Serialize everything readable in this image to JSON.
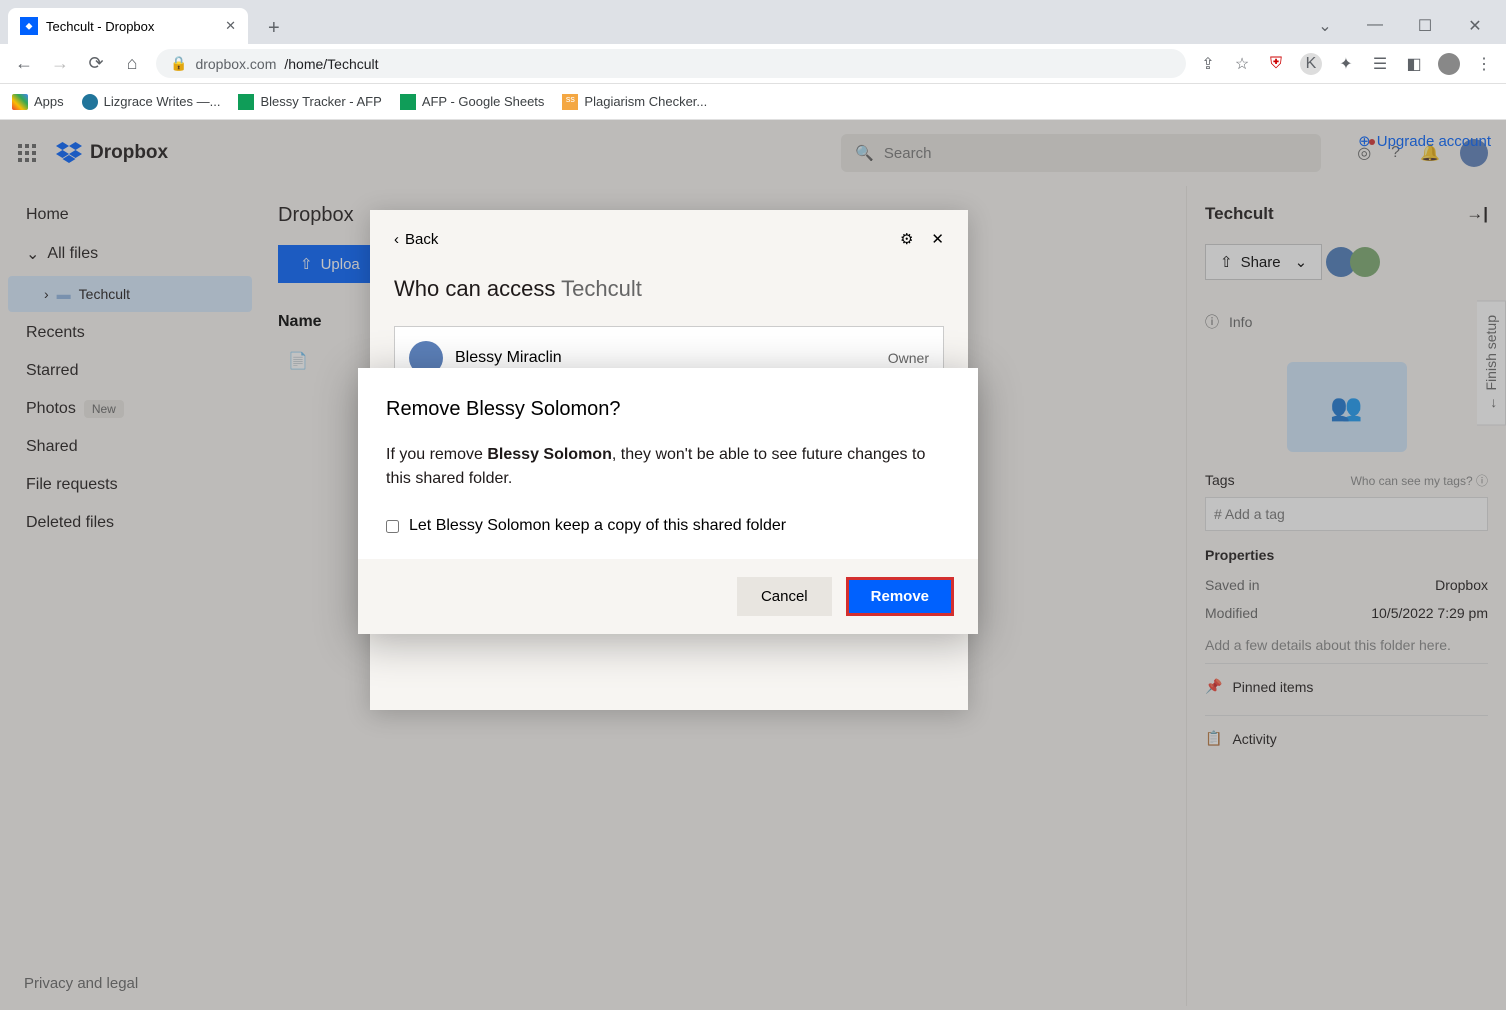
{
  "browser": {
    "tab_title": "Techcult - Dropbox",
    "url_domain": "dropbox.com",
    "url_path": "/home/Techcult",
    "bookmarks": [
      "Apps",
      "Lizgrace Writes —...",
      "Blessy Tracker - AFP",
      "AFP - Google Sheets",
      "Plagiarism Checker..."
    ]
  },
  "app": {
    "upgrade": "Upgrade account",
    "logo": "Dropbox",
    "search_placeholder": "Search",
    "sidebar": {
      "home": "Home",
      "allfiles": "All files",
      "folder": "Techcult",
      "recents": "Recents",
      "starred": "Starred",
      "photos": "Photos",
      "photos_badge": "New",
      "shared": "Shared",
      "filereq": "File requests",
      "deleted": "Deleted files"
    },
    "breadcrumb": "Dropbox",
    "upload": "Uploa",
    "col_name": "Name",
    "privacy": "Privacy and legal",
    "finish_setup": "Finish setup"
  },
  "share_panel": {
    "back": "Back",
    "title_prefix": "Who can access ",
    "title_folder": "Techcult",
    "member_name": "Blessy Miraclin",
    "member_role": "Owner"
  },
  "right": {
    "title": "Techcult",
    "share": "Share",
    "info": "Info",
    "tags": "Tags",
    "tags_q": "Who can see my tags?",
    "tag_ph": "# Add a tag",
    "props": "Properties",
    "saved_k": "Saved in",
    "saved_v": "Dropbox",
    "mod_k": "Modified",
    "mod_v": "10/5/2022 7:29 pm",
    "details": "Add a few details about this folder here.",
    "pinned": "Pinned items",
    "activity": "Activity"
  },
  "modal": {
    "title": "Remove Blessy Solomon?",
    "text_pre": "If you remove ",
    "text_bold": "Blessy Solomon",
    "text_post": ", they won't be able to see future changes to this shared folder.",
    "checkbox": "Let Blessy Solomon keep a copy of this shared folder",
    "cancel": "Cancel",
    "remove": "Remove"
  }
}
